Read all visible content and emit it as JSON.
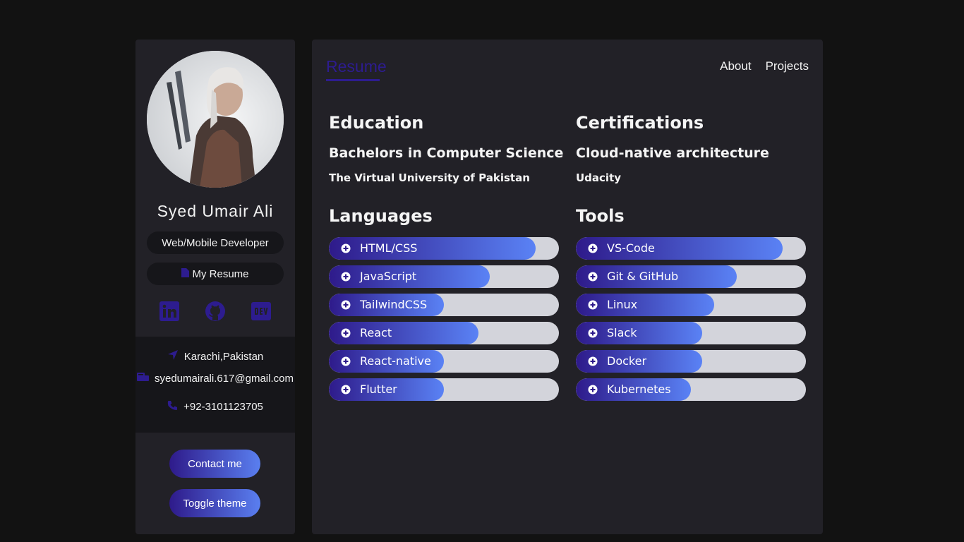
{
  "profile": {
    "name": "Syed Umair Ali",
    "role": "Web/Mobile Developer",
    "resume_label": "My Resume",
    "socials": [
      "linkedin-icon",
      "github-icon",
      "devto-icon"
    ],
    "location": "Karachi,Pakistan",
    "email": "syedumairali.617@gmail.com",
    "phone": "+92-3101123705",
    "contact_button": "Contact me",
    "toggle_button": "Toggle theme"
  },
  "header": {
    "active_tab": "Resume",
    "nav": [
      "About",
      "Projects"
    ]
  },
  "education": {
    "heading": "Education",
    "degree": "Bachelors in Computer Science",
    "institution": "The Virtual University of Pakistan"
  },
  "certifications": {
    "heading": "Certifications",
    "title": "Cloud-native architecture",
    "issuer": "Udacity"
  },
  "languages": {
    "heading": "Languages",
    "items": [
      {
        "label": "HTML/CSS",
        "level": 0.9
      },
      {
        "label": "JavaScript",
        "level": 0.7
      },
      {
        "label": "TailwindCSS",
        "level": 0.5
      },
      {
        "label": "React",
        "level": 0.65
      },
      {
        "label": "React-native",
        "level": 0.5
      },
      {
        "label": "Flutter",
        "level": 0.5
      }
    ]
  },
  "tools": {
    "heading": "Tools",
    "items": [
      {
        "label": "VS-Code",
        "level": 0.9
      },
      {
        "label": "Git & GitHub",
        "level": 0.7
      },
      {
        "label": "Linux",
        "level": 0.6
      },
      {
        "label": "Slack",
        "level": 0.55
      },
      {
        "label": "Docker",
        "level": 0.55
      },
      {
        "label": "Kubernetes",
        "level": 0.5
      }
    ]
  },
  "colors": {
    "accent": "#2d1c8f",
    "gradient_start": "#2e1a8a",
    "gradient_end": "#5a82f5",
    "panel": "#222127",
    "page_bg": "#121212"
  }
}
